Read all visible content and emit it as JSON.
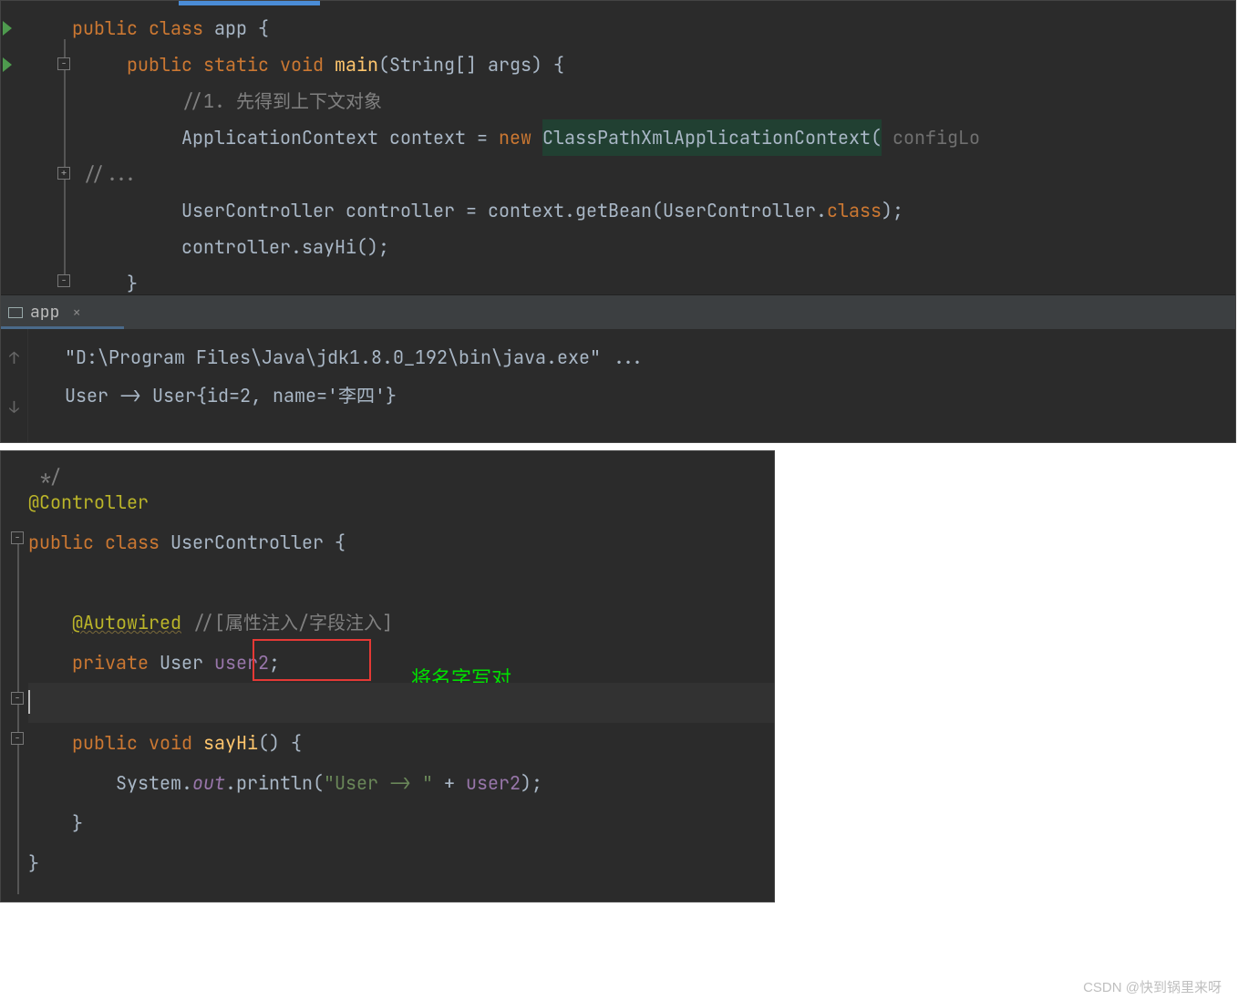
{
  "editor1": {
    "line1": {
      "kw1": "public",
      "kw2": "class",
      "cls": "app",
      "brace": " {"
    },
    "line2": {
      "kw1": "public",
      "kw2": "static",
      "kw3": "void",
      "met": "main",
      "sig": "(String[] args) {"
    },
    "line3": {
      "com": "//1. 先得到上下文对象"
    },
    "line4": {
      "t1": "ApplicationContext context = ",
      "kw": "new",
      "sp": " ",
      "hl": "ClassPathXmlApplicationContext(",
      "hint": " configLo"
    },
    "line5": {
      "com": "//..."
    },
    "line6": {
      "t1": "UserController controller = context.getBean(UserController.",
      "kw": "class",
      "t2": ");"
    },
    "line7": {
      "t1": "controller.sayHi();"
    },
    "line8": {
      "brace": "}"
    }
  },
  "tab": {
    "label": "app",
    "close": "×"
  },
  "console": {
    "line1": "\"D:\\Program Files\\Java\\jdk1.8.0_192\\bin\\java.exe\" ...",
    "line2": "User -> User{id=2, name='李四'}"
  },
  "editor2": {
    "commentTop": "*/",
    "line_ann": "@Controller",
    "line_cls": {
      "kw1": "public",
      "kw2": "class",
      "cls": "UserController",
      "brace": " {"
    },
    "line_auto": {
      "ann": "@Autowired",
      "com": " //[属性注入/字段注入]"
    },
    "line_priv": {
      "kw": "private",
      "typ": " User ",
      "var": "user2",
      "semi": ";"
    },
    "note": "将名字写对",
    "line_method": {
      "kw1": "public",
      "kw2": "void",
      "met": "sayHi",
      "sig": "() {"
    },
    "line_print": {
      "t1": "System.",
      "out": "out",
      "t2": ".println(",
      "str": "\"User -> \"",
      "t3": " + ",
      "var": "user2",
      "t4": ");"
    },
    "brace1": "}",
    "brace2": "}"
  },
  "watermark": "CSDN @快到锅里来呀"
}
